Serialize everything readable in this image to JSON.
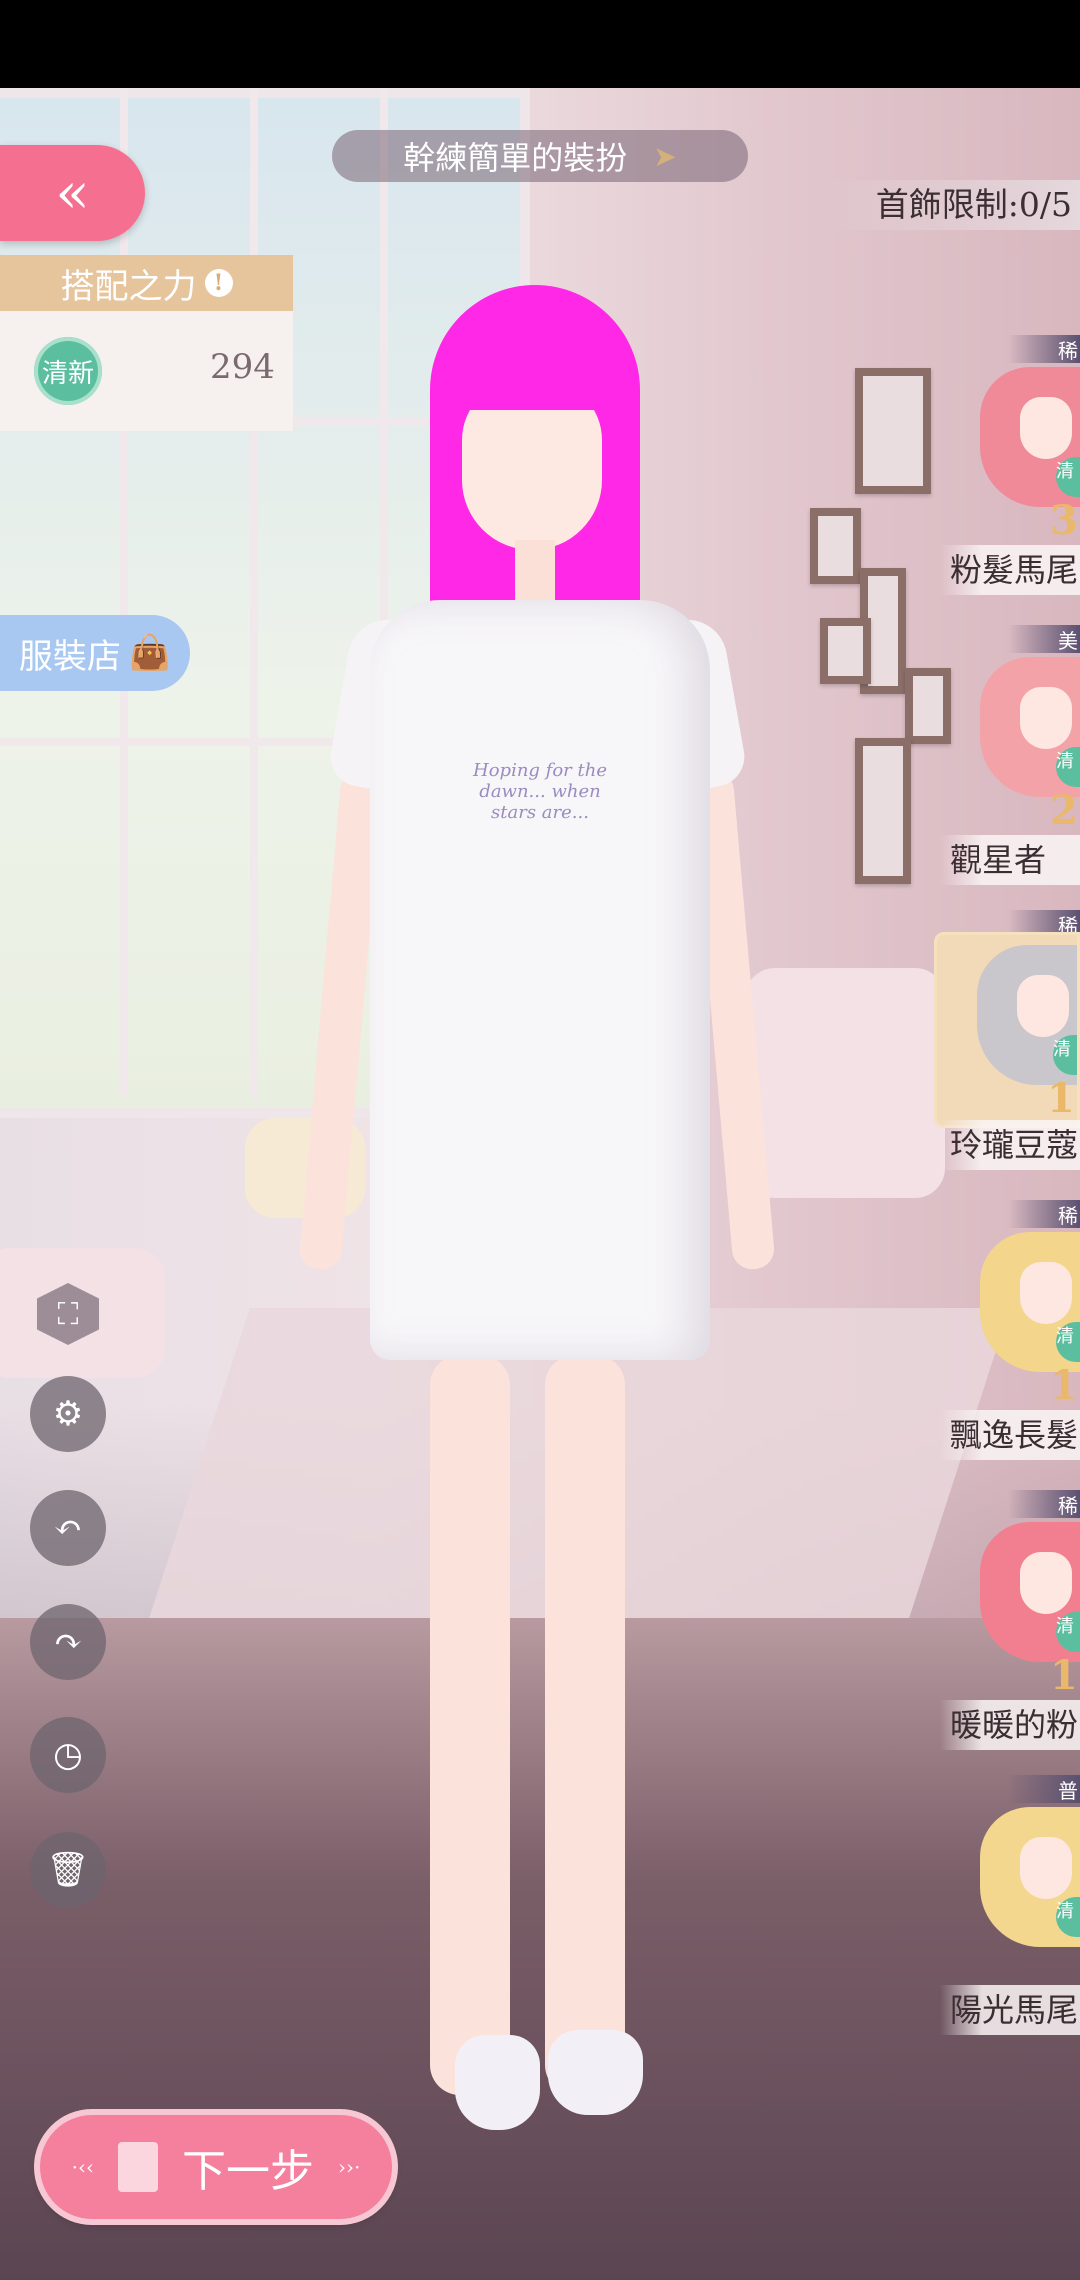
{
  "header": {
    "title": "幹練簡單的裝扮",
    "back_glyph": "«",
    "accessory_limit": "首飾限制:0/5"
  },
  "power_panel": {
    "label": "搭配之力",
    "info_glyph": "!",
    "tag": "清新",
    "value": "294"
  },
  "shop": {
    "label": "服裝店",
    "icon": "shopping-bag-icon"
  },
  "tools": [
    {
      "name": "expand-icon",
      "glyph": "⛶"
    },
    {
      "name": "gear-icon",
      "glyph": "⚙"
    },
    {
      "name": "undo-icon",
      "glyph": "↶"
    },
    {
      "name": "redo-icon",
      "glyph": "↷"
    },
    {
      "name": "clock-icon",
      "glyph": "◷"
    },
    {
      "name": "trash-icon",
      "glyph": "🗑"
    }
  ],
  "next_button": {
    "label": "下一步",
    "deco_left": "·‹‹",
    "deco_right": "››·"
  },
  "character": {
    "shirt_print": "Hoping for the dawn... when stars are..."
  },
  "items": [
    {
      "category": "稀",
      "name": "粉髮馬尾",
      "badge": "清",
      "number": "3",
      "hair_color": "#f08a98"
    },
    {
      "category": "美",
      "name": "觀星者",
      "badge": "清",
      "number": "2",
      "hair_color": "#f3a3a8"
    },
    {
      "category": "稀",
      "name": "玲瓏豆蔻",
      "badge": "清",
      "number": "1",
      "hair_color": "#c9c7cb",
      "selected": true
    },
    {
      "category": "稀",
      "name": "飄逸長髮・",
      "badge": "清",
      "number": "1",
      "hair_color": "#f3d58c"
    },
    {
      "category": "稀",
      "name": "暖暖的粉",
      "badge": "清",
      "number": "1",
      "hair_color": "#f27f90"
    },
    {
      "category": "普",
      "name": "陽光馬尾",
      "badge": "清",
      "number": "",
      "hair_color": "#f3d78e"
    }
  ],
  "colors": {
    "accent_pink": "#f56f90",
    "power_gold": "#e6c49c",
    "fresh_green": "#5bbf9f",
    "shop_blue": "#a8c8f2",
    "hair_magenta": "#ff28e6"
  }
}
